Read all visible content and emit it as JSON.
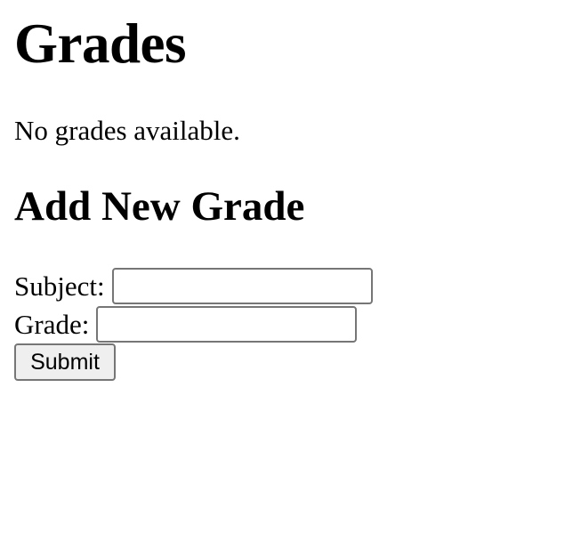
{
  "page": {
    "title": "Grades",
    "empty_message": "No grades available."
  },
  "form": {
    "heading": "Add New Grade",
    "subject_label": "Subject:",
    "subject_value": "",
    "grade_label": "Grade:",
    "grade_value": "",
    "submit_label": "Submit"
  }
}
